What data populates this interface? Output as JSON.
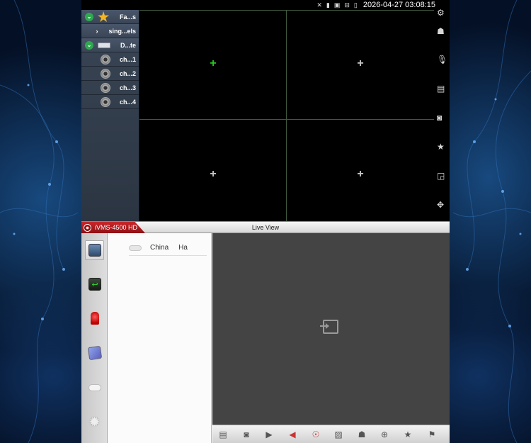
{
  "statusbar": {
    "icons": [
      "mute-icon",
      "sdcard-icon",
      "screenshot-icon",
      "usb-debug-icon",
      "battery-icon"
    ],
    "clock": "2026-04-27 03:08:15"
  },
  "device_tree": {
    "rows": [
      {
        "label": "Fa...s",
        "icon": "star-icon",
        "expand": "expanded"
      },
      {
        "label": "sing...els",
        "icon": "chevron-right-icon",
        "expand": "collapsed"
      },
      {
        "label": "D...te",
        "icon": "dvr-icon",
        "expand": "expanded"
      },
      {
        "label": "ch...1",
        "icon": "camera-icon"
      },
      {
        "label": "ch...2",
        "icon": "camera-icon"
      },
      {
        "label": "ch...3",
        "icon": "camera-icon"
      },
      {
        "label": "ch...4",
        "icon": "camera-icon"
      }
    ]
  },
  "grid": {
    "windows": [
      "+",
      "+",
      "+",
      "+"
    ],
    "active_color": "#22cc22"
  },
  "tool_rail": {
    "icons": [
      "gear-icon",
      "ptz-icon",
      "microphone-icon",
      "picture-icon",
      "camera-icon",
      "star-icon",
      "window-icon",
      "move-icon"
    ],
    "glyphs": [
      "⚙",
      "☗",
      "🎙",
      "▤",
      "◙",
      "★",
      "◲",
      "✥"
    ]
  },
  "main": {
    "app_name": "iVMS-4500 HD",
    "title": "Live View",
    "region": {
      "label1": "China",
      "label2": "Ha"
    },
    "brand_color": "#b8181d",
    "toolbar_glyphs": [
      "▤",
      "◙",
      "▶",
      "◀",
      "☉",
      "▨",
      "☗",
      "⊕",
      "★",
      "⚑"
    ]
  }
}
